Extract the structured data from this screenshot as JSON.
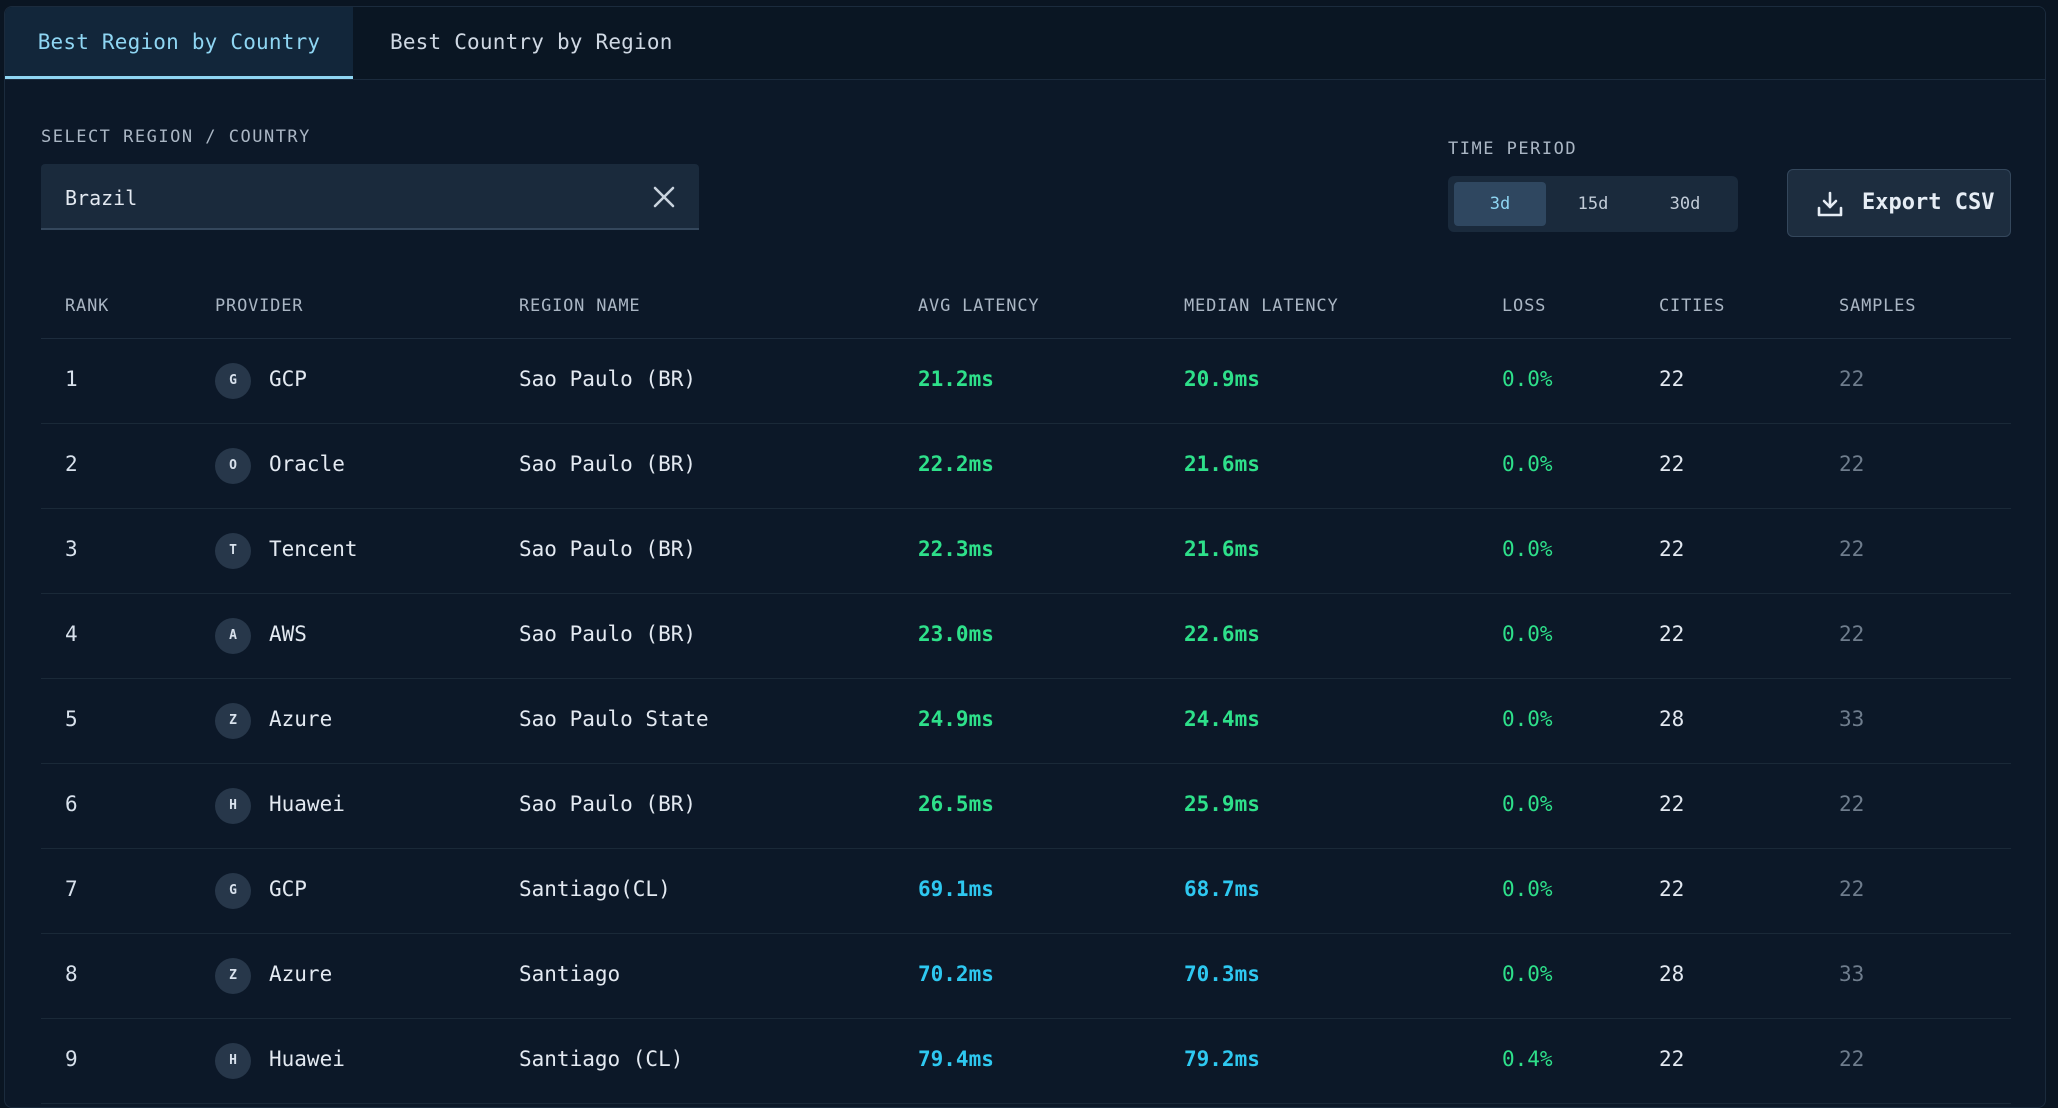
{
  "tabs": [
    {
      "label": "Best Region by Country",
      "active": true
    },
    {
      "label": "Best Country by Region",
      "active": false
    }
  ],
  "filters": {
    "region_label": "SELECT REGION / COUNTRY",
    "region_value": "Brazil",
    "time_label": "TIME PERIOD",
    "periods": [
      "3d",
      "15d",
      "30d"
    ],
    "selected_period": "3d",
    "export_label": "Export CSV"
  },
  "colors": {
    "good_latency": "#2ee08a",
    "medium_latency": "#2ec8f0",
    "accent": "#8fd6f3"
  },
  "table": {
    "headers": {
      "rank": "RANK",
      "provider": "PROVIDER",
      "region": "REGION NAME",
      "avg": "AVG LATENCY",
      "median": "MEDIAN LATENCY",
      "loss": "LOSS",
      "cities": "CITIES",
      "samples": "SAMPLES"
    },
    "rows": [
      {
        "rank": "1",
        "badge": "G",
        "provider": "GCP",
        "region": "Sao Paulo (BR)",
        "avg": "21.2ms",
        "median": "20.9ms",
        "loss": "0.0%",
        "cities": "22",
        "samples": "22",
        "tier": "green"
      },
      {
        "rank": "2",
        "badge": "O",
        "provider": "Oracle",
        "region": "Sao Paulo (BR)",
        "avg": "22.2ms",
        "median": "21.6ms",
        "loss": "0.0%",
        "cities": "22",
        "samples": "22",
        "tier": "green"
      },
      {
        "rank": "3",
        "badge": "T",
        "provider": "Tencent",
        "region": "Sao Paulo (BR)",
        "avg": "22.3ms",
        "median": "21.6ms",
        "loss": "0.0%",
        "cities": "22",
        "samples": "22",
        "tier": "green"
      },
      {
        "rank": "4",
        "badge": "A",
        "provider": "AWS",
        "region": "Sao Paulo (BR)",
        "avg": "23.0ms",
        "median": "22.6ms",
        "loss": "0.0%",
        "cities": "22",
        "samples": "22",
        "tier": "green"
      },
      {
        "rank": "5",
        "badge": "Z",
        "provider": "Azure",
        "region": "Sao Paulo State",
        "avg": "24.9ms",
        "median": "24.4ms",
        "loss": "0.0%",
        "cities": "28",
        "samples": "33",
        "tier": "green"
      },
      {
        "rank": "6",
        "badge": "H",
        "provider": "Huawei",
        "region": "Sao Paulo (BR)",
        "avg": "26.5ms",
        "median": "25.9ms",
        "loss": "0.0%",
        "cities": "22",
        "samples": "22",
        "tier": "green"
      },
      {
        "rank": "7",
        "badge": "G",
        "provider": "GCP",
        "region": "Santiago(CL)",
        "avg": "69.1ms",
        "median": "68.7ms",
        "loss": "0.0%",
        "cities": "22",
        "samples": "22",
        "tier": "blue"
      },
      {
        "rank": "8",
        "badge": "Z",
        "provider": "Azure",
        "region": "Santiago",
        "avg": "70.2ms",
        "median": "70.3ms",
        "loss": "0.0%",
        "cities": "28",
        "samples": "33",
        "tier": "blue"
      },
      {
        "rank": "9",
        "badge": "H",
        "provider": "Huawei",
        "region": "Santiago (CL)",
        "avg": "79.4ms",
        "median": "79.2ms",
        "loss": "0.4%",
        "cities": "22",
        "samples": "22",
        "tier": "blue"
      }
    ]
  }
}
